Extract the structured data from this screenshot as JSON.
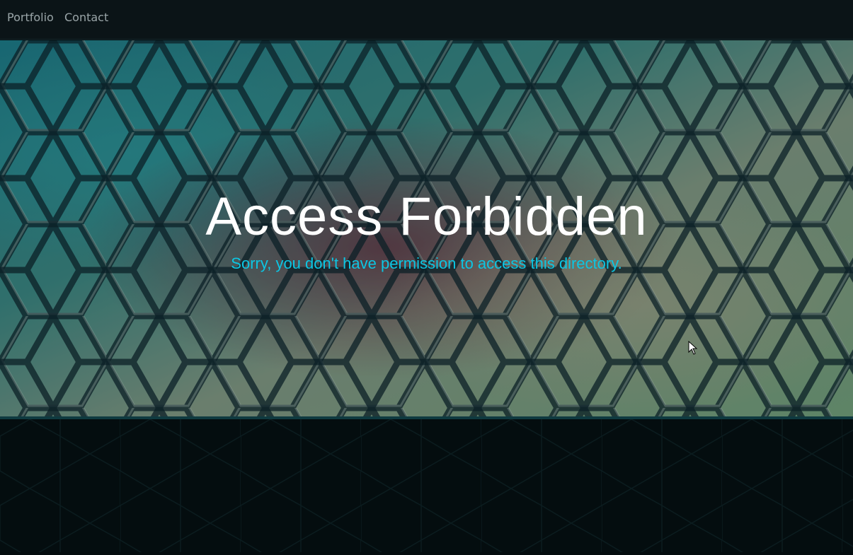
{
  "nav": {
    "links": [
      {
        "label": "Portfolio"
      },
      {
        "label": "Contact"
      }
    ]
  },
  "hero": {
    "title": "Access Forbidden",
    "subtitle": "Sorry, you don't have permission to access this directory."
  },
  "colors": {
    "nav_bg": "#0b1417",
    "nav_text": "#9aa5a8",
    "title": "#ffffff",
    "subtitle": "#0cc6e3",
    "page_bg": "#040c0e"
  }
}
